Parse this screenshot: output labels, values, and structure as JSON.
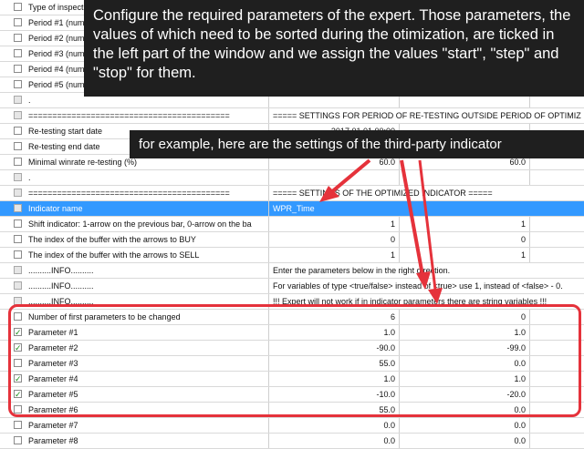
{
  "rows": [
    {
      "id": "type-inspect",
      "label": "Type of inspect",
      "checked": false,
      "disabled": false,
      "v1": "",
      "v2": "",
      "wide": "",
      "selected": false
    },
    {
      "id": "period-1",
      "label": "Period #1 (numb",
      "checked": false,
      "disabled": false,
      "v1": "",
      "v2": "",
      "wide": "",
      "selected": false
    },
    {
      "id": "period-2",
      "label": "Period #2 (numb",
      "checked": false,
      "disabled": false,
      "v1": "",
      "v2": "",
      "wide": "",
      "selected": false
    },
    {
      "id": "period-3",
      "label": "Period #3 (numb",
      "checked": false,
      "disabled": false,
      "v1": "",
      "v2": "",
      "wide": "",
      "selected": false
    },
    {
      "id": "period-4",
      "label": "Period #4 (numb",
      "checked": false,
      "disabled": false,
      "v1": "",
      "v2": "",
      "wide": "",
      "selected": false
    },
    {
      "id": "period-5",
      "label": "Period #5 (numb",
      "checked": false,
      "disabled": false,
      "v1": "",
      "v2": "",
      "wide": "",
      "selected": false
    },
    {
      "id": "dot-1",
      "label": ".",
      "checked": false,
      "disabled": true,
      "v1": "",
      "v2": "",
      "wide": "",
      "selected": false
    },
    {
      "id": "settings-retest-header",
      "label": "==========================================",
      "checked": false,
      "disabled": true,
      "v1": "",
      "v2": "",
      "wide": "===== SETTINGS FOR PERIOD OF RE-TESTING OUTSIDE PERIOD OF OPTIMIZ",
      "selected": false
    },
    {
      "id": "retest-start",
      "label": "Re-testing start date",
      "checked": false,
      "disabled": false,
      "v1": "2017.01.01 00:00",
      "v2": "",
      "wide": "",
      "selected": false
    },
    {
      "id": "retest-end",
      "label": "Re-testing end date",
      "checked": false,
      "disabled": false,
      "v1": "",
      "v2": "",
      "wide": "",
      "selected": false
    },
    {
      "id": "min-winrate",
      "label": "Minimal winrate re-testing (%)",
      "checked": false,
      "disabled": false,
      "v1": "60.0",
      "v2": "60.0",
      "wide": "",
      "selected": false
    },
    {
      "id": "dot-2",
      "label": ".",
      "checked": false,
      "disabled": true,
      "v1": "",
      "v2": "",
      "wide": "",
      "selected": false
    },
    {
      "id": "settings-indicator-header",
      "label": "==========================================",
      "checked": false,
      "disabled": true,
      "v1": "",
      "v2": "",
      "wide": "===== SETTINGS OF THE OPTIMIZED INDICATOR =====",
      "selected": false
    },
    {
      "id": "indicator-name",
      "label": "Indicator name",
      "checked": false,
      "disabled": true,
      "v1": "",
      "v2": "",
      "wide": "WPR_Time",
      "selected": true
    },
    {
      "id": "shift-indicator",
      "label": "Shift indicator: 1-arrow on the previous bar, 0-arrow on the ba",
      "checked": false,
      "disabled": false,
      "v1": "1",
      "v2": "1",
      "wide": "",
      "selected": false
    },
    {
      "id": "buffer-buy",
      "label": "The index of the buffer with the arrows to BUY",
      "checked": false,
      "disabled": false,
      "v1": "0",
      "v2": "0",
      "wide": "",
      "selected": false
    },
    {
      "id": "buffer-sell",
      "label": "The index of the buffer with the arrows to SELL",
      "checked": false,
      "disabled": false,
      "v1": "1",
      "v2": "1",
      "wide": "",
      "selected": false
    },
    {
      "id": "info-1",
      "label": "..........INFO..........",
      "checked": false,
      "disabled": true,
      "v1": "",
      "v2": "",
      "wide": "Enter the parameters below in the right direction.",
      "selected": false
    },
    {
      "id": "info-2",
      "label": "..........INFO..........",
      "checked": false,
      "disabled": true,
      "v1": "",
      "v2": "",
      "wide": "For variables of type <true/false> instead of <true> use 1, instead of <false> - 0.",
      "selected": false
    },
    {
      "id": "info-3",
      "label": "..........INFO..........",
      "checked": false,
      "disabled": true,
      "v1": "",
      "v2": "",
      "wide": "!!! Expert will not work if in indicator parameters there are string variables !!!",
      "selected": false
    },
    {
      "id": "num-first-params",
      "label": "Number of first parameters to be changed",
      "checked": false,
      "disabled": false,
      "v1": "6",
      "v2": "0",
      "wide": "",
      "selected": false
    },
    {
      "id": "parameter-1",
      "label": "Parameter #1",
      "checked": true,
      "disabled": false,
      "v1": "1.0",
      "v2": "1.0",
      "wide": "",
      "selected": false
    },
    {
      "id": "parameter-2",
      "label": "Parameter #2",
      "checked": true,
      "disabled": false,
      "v1": "-90.0",
      "v2": "-99.0",
      "wide": "",
      "selected": false
    },
    {
      "id": "parameter-3",
      "label": "Parameter #3",
      "checked": false,
      "disabled": false,
      "v1": "55.0",
      "v2": "0.0",
      "wide": "",
      "selected": false
    },
    {
      "id": "parameter-4",
      "label": "Parameter #4",
      "checked": true,
      "disabled": false,
      "v1": "1.0",
      "v2": "1.0",
      "wide": "",
      "selected": false
    },
    {
      "id": "parameter-5",
      "label": "Parameter #5",
      "checked": true,
      "disabled": false,
      "v1": "-10.0",
      "v2": "-20.0",
      "wide": "",
      "selected": false
    },
    {
      "id": "parameter-6",
      "label": "Parameter #6",
      "checked": false,
      "disabled": false,
      "v1": "55.0",
      "v2": "0.0",
      "wide": "",
      "selected": false
    },
    {
      "id": "parameter-7",
      "label": "Parameter #7",
      "checked": false,
      "disabled": false,
      "v1": "0.0",
      "v2": "0.0",
      "wide": "",
      "selected": false
    },
    {
      "id": "parameter-8",
      "label": "Parameter #8",
      "checked": false,
      "disabled": false,
      "v1": "0.0",
      "v2": "0.0",
      "wide": "",
      "selected": false
    }
  ],
  "overlay_main": "Configure the required parameters of the expert. Those parameters, the values of which need to be sorted during the otimization, are ticked in the left part of the window and we assign the values \"start\", \"step\" and \"stop\" for them.",
  "overlay_example": "for example, here are the settings of the third-party indicator",
  "check_glyph": "✓",
  "colors": {
    "highlight": "#3399ff",
    "annotation": "#e5323b",
    "overlay": "#1f1f1f",
    "check": "#1a8f1a"
  }
}
